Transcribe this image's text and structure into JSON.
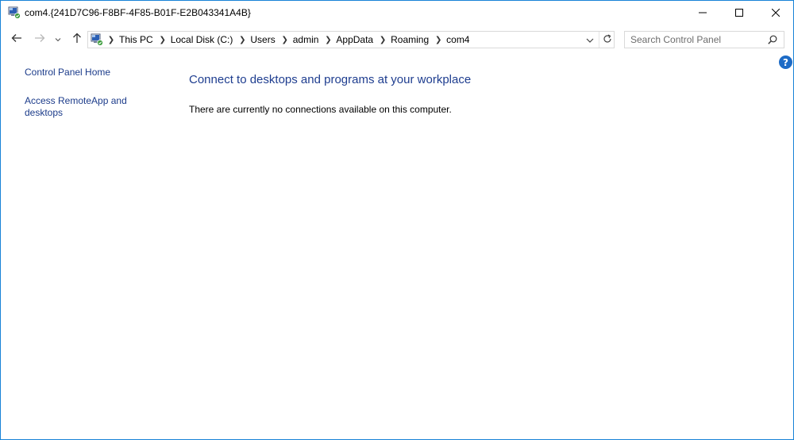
{
  "window": {
    "title": "com4.{241D7C96-F8BF-4F85-B01F-E2B043341A4B}",
    "icon": "remoteapp-folder-icon"
  },
  "controls": {
    "minimize_icon": "minimize-icon",
    "maximize_icon": "maximize-icon",
    "close_icon": "close-icon"
  },
  "nav": {
    "back_icon": "arrow-left-icon",
    "forward_icon": "arrow-right-icon",
    "recent_icon": "chevron-down-icon",
    "up_icon": "arrow-up-icon"
  },
  "address": {
    "breadcrumbs": [
      "This PC",
      "Local Disk (C:)",
      "Users",
      "admin",
      "AppData",
      "Roaming",
      "com4"
    ]
  },
  "search": {
    "placeholder": "Search Control Panel",
    "value": ""
  },
  "help_label": "?",
  "sidebar": {
    "home_label": "Control Panel Home",
    "remote_label": "Access RemoteApp and desktops"
  },
  "main": {
    "title": "Connect to desktops and programs at your workplace",
    "message": "There are currently no connections available on this computer."
  },
  "colors": {
    "link": "#1b3b8a",
    "heading": "#1e3d8f",
    "help_bg": "#1d6bc6",
    "window_border": "#1883d7"
  }
}
